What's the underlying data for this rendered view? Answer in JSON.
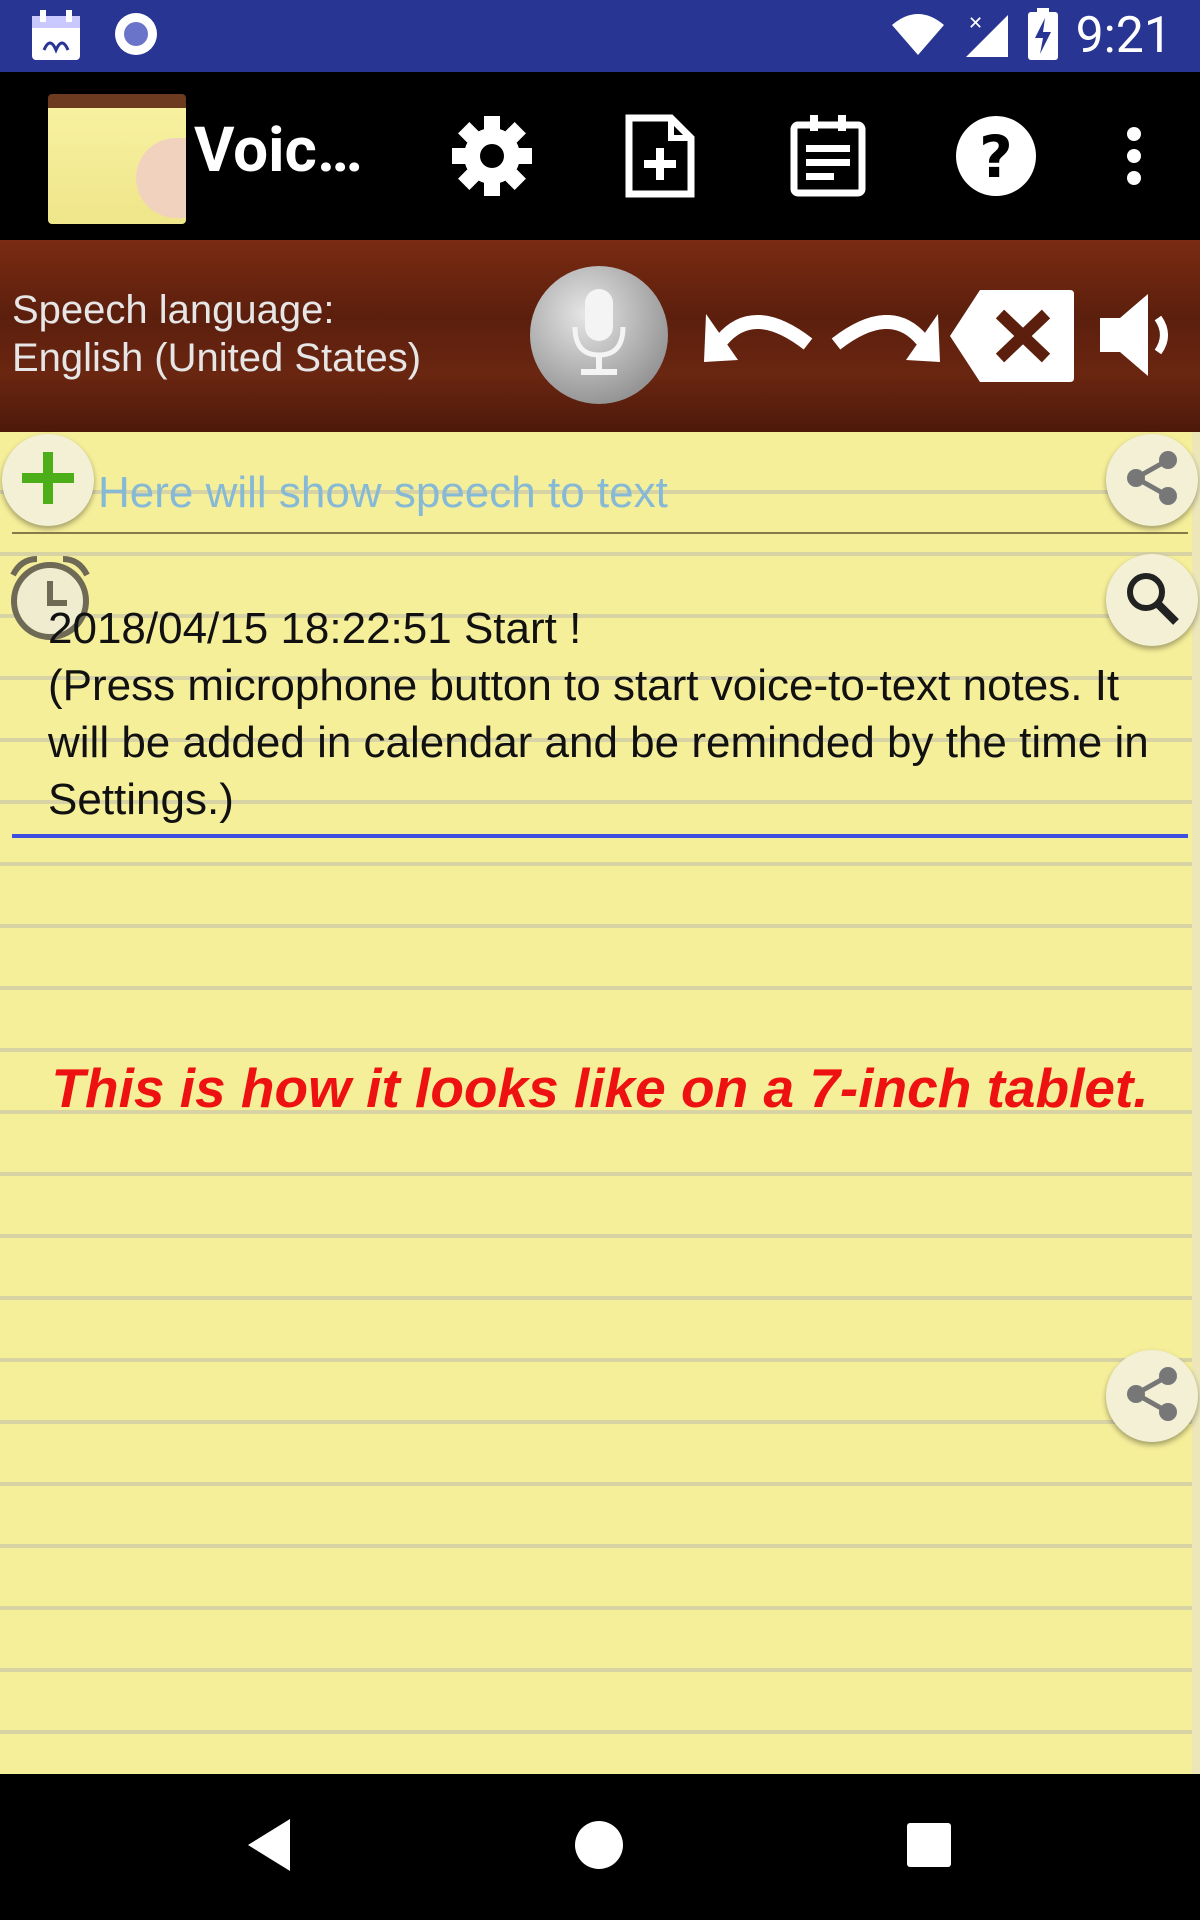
{
  "status_bar": {
    "time": "9:21",
    "icons": [
      "calendar-notification-icon",
      "record-indicator-icon",
      "wifi-icon",
      "cell-signal-icon",
      "battery-charging-icon"
    ]
  },
  "app_bar": {
    "title": "Voice…",
    "actions": [
      "settings-icon",
      "new-note-icon",
      "notes-list-icon",
      "help-icon",
      "overflow-menu-icon"
    ]
  },
  "controls": {
    "speech_language_label": "Speech language:",
    "speech_language_value": "English (United States)",
    "buttons": [
      "microphone-icon",
      "undo-icon",
      "redo-icon",
      "clear-icon",
      "speaker-icon"
    ]
  },
  "editor": {
    "speech_placeholder": "Here will show speech to text",
    "note_line1": "2018/04/15 18:22:51 Start !",
    "note_body": "(Press microphone button to start voice-to-text notes. It will be added in calendar and be reminded by the time in Settings.)"
  },
  "banner": {
    "text": "This is how it looks like on a 7-inch tablet."
  },
  "colors": {
    "status_bar": "#283593",
    "paper": "#f6ef9a",
    "banner_text": "#ee1111",
    "placeholder": "#86b9d6",
    "note_underline": "#3c4fe0"
  }
}
